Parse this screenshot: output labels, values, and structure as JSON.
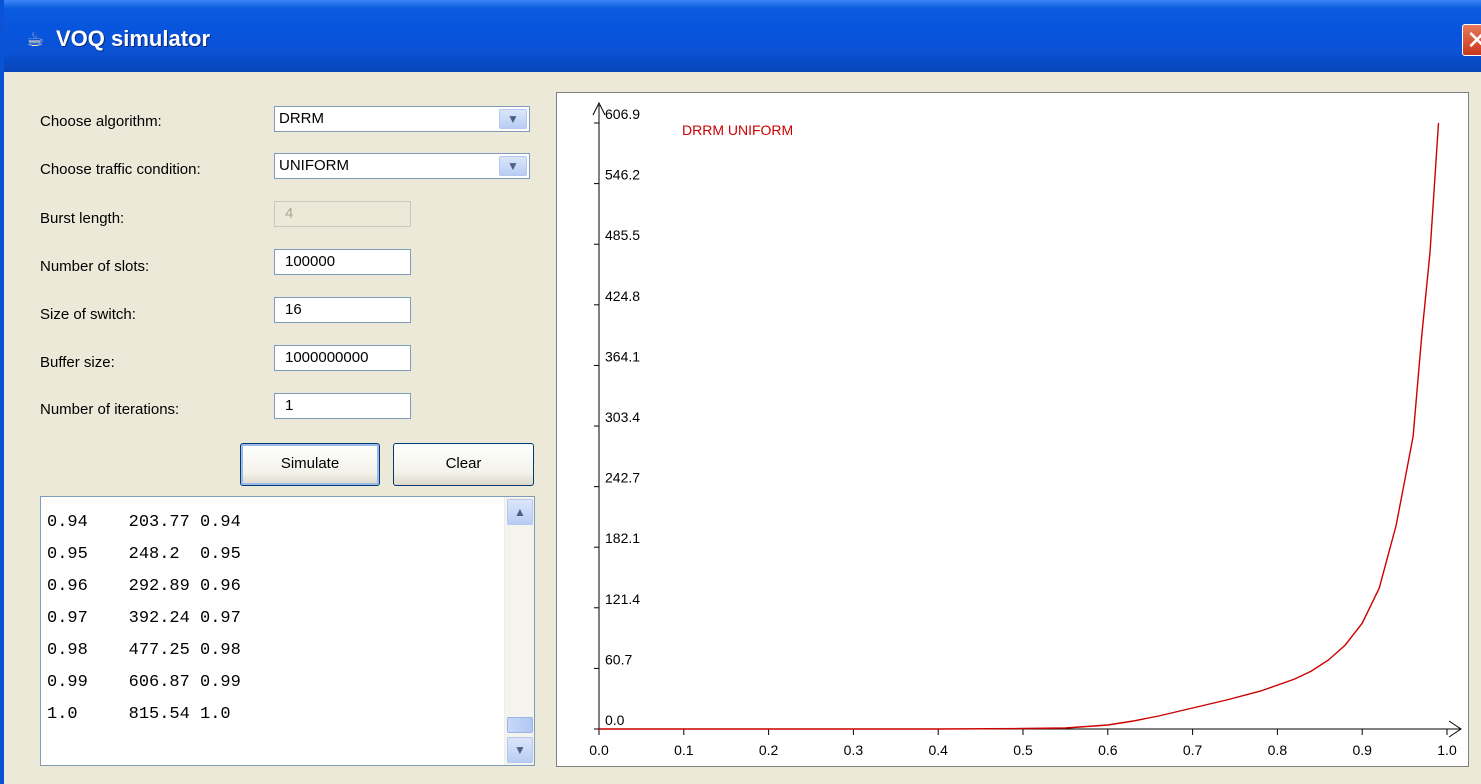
{
  "window": {
    "title": "VOQ simulator",
    "icon": "java-cup-icon",
    "close_glyph": "✕"
  },
  "form": {
    "algorithm_label": "Choose algorithm:",
    "algorithm_value": "DRRM",
    "traffic_label": "Choose traffic condition:",
    "traffic_value": "UNIFORM",
    "burst_label": "Burst length:",
    "burst_value": "4",
    "slots_label": "Number of slots:",
    "slots_value": "100000",
    "switch_label": "Size of switch:",
    "switch_value": "16",
    "buffer_label": "Buffer size:",
    "buffer_value": "1000000000",
    "iterations_label": "Number of iterations:",
    "iterations_value": "1"
  },
  "buttons": {
    "simulate": "Simulate",
    "clear": "Clear"
  },
  "output": {
    "lines": [
      "0.94    203.77 0.94",
      "0.95    248.2  0.95",
      "0.96    292.89 0.96",
      "0.97    392.24 0.97",
      "0.98    477.25 0.98",
      "0.99    606.87 0.99",
      "1.0     815.54 1.0"
    ]
  },
  "chart_data": {
    "type": "line",
    "series_label": "DRRM UNIFORM",
    "series_color": "#cc0000",
    "x_ticks": [
      "0.0",
      "0.1",
      "0.2",
      "0.3",
      "0.4",
      "0.5",
      "0.6",
      "0.7",
      "0.8",
      "0.9",
      "1.0"
    ],
    "y_ticks": [
      "0.0",
      "60.7",
      "121.4",
      "182.1",
      "242.7",
      "303.4",
      "364.1",
      "424.8",
      "485.5",
      "546.2",
      "606.9"
    ],
    "xlim": [
      0,
      1.0
    ],
    "ylim": [
      0,
      606.9
    ],
    "series": [
      {
        "name": "DRRM UNIFORM",
        "x": [
          0.0,
          0.1,
          0.2,
          0.3,
          0.4,
          0.5,
          0.55,
          0.6,
          0.63,
          0.66,
          0.7,
          0.74,
          0.78,
          0.82,
          0.84,
          0.86,
          0.88,
          0.9,
          0.92,
          0.94,
          0.95,
          0.96,
          0.97,
          0.98,
          0.99
        ],
        "y": [
          0.0,
          0.0,
          0.0,
          0.0,
          0.0,
          0.5,
          1.0,
          4.0,
          8.0,
          13.0,
          21.0,
          29.0,
          38.0,
          50.0,
          58.0,
          69.0,
          84.0,
          106.0,
          141.0,
          203.77,
          248.2,
          292.89,
          392.24,
          477.25,
          606.87
        ]
      }
    ]
  }
}
